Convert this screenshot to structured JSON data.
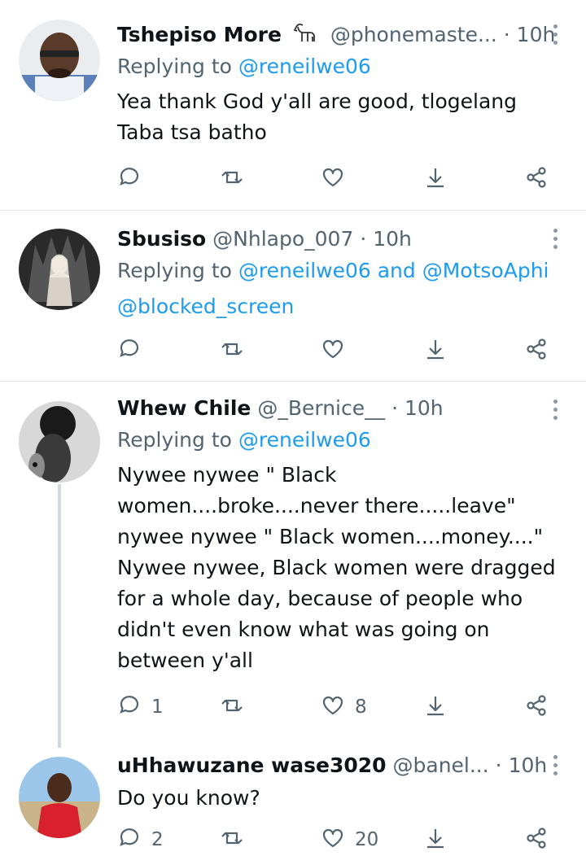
{
  "tweets": [
    {
      "name": "Tshepiso More",
      "handle": "@phonemaste...",
      "dot": "·",
      "time": "10h",
      "reply_prefix": "Replying to",
      "reply_users": "@reneilwe06",
      "text": "Yea thank God y'all are good, tlogelang Taba tsa batho",
      "counts": {
        "reply": "",
        "retweet": "",
        "like": ""
      }
    },
    {
      "name": "Sbusiso",
      "handle": "@Nhlapo_007",
      "dot": "·",
      "time": "10h",
      "reply_prefix": "Replying to",
      "reply_users": "@reneilwe06",
      "reply_and": "and",
      "reply_users2": "@MotsoAphi",
      "reply_users3": "@blocked_screen",
      "counts": {
        "reply": "",
        "retweet": "",
        "like": ""
      }
    },
    {
      "name": "Whew Chile",
      "handle": "@_Bernice__",
      "dot": "·",
      "time": "10h",
      "reply_prefix": "Replying to",
      "reply_users": "@reneilwe06",
      "text": "Nywee nywee \" Black women....broke....never there.....leave\" nywee nywee \" Black women....money....\" Nywee nywee, Black women were dragged for a whole day, because of people who didn't even know what was going on between y'all",
      "counts": {
        "reply": "1",
        "retweet": "",
        "like": "8"
      }
    },
    {
      "name": "uHhawuzane wase3020",
      "handle": "@banel...",
      "dot": "·",
      "time": "10h",
      "text": "Do you know?",
      "counts": {
        "reply": "2",
        "retweet": "",
        "like": "20"
      }
    }
  ],
  "icons": {
    "reply": "reply-icon",
    "retweet": "retweet-icon",
    "like": "heart-icon",
    "bookmark": "bookmark-download-icon",
    "share": "share-icon",
    "more": "more-vertical-icon"
  },
  "colors": {
    "link": "#1d9bf0",
    "muted": "#536471",
    "text": "#0f1419"
  }
}
